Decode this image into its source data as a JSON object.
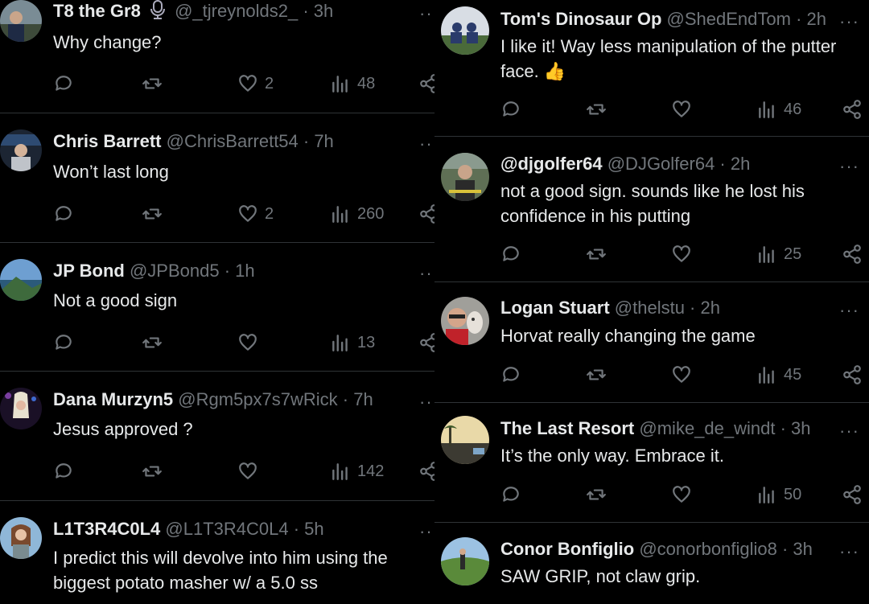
{
  "left_column": [
    {
      "name": "T8 the Gr8",
      "handle": "@_tjreynolds2_ · 3h",
      "text": "Why change?",
      "likes": "2",
      "views": "48"
    },
    {
      "name": "Chris Barrett",
      "handle": "@ChrisBarrett54 · 7h",
      "text": "Won’t last long",
      "likes": "2",
      "views": "260"
    },
    {
      "name": "JP Bond",
      "handle": "@JPBond5 · 1h",
      "text": "Not a good sign",
      "likes": "",
      "views": "13"
    },
    {
      "name": "Dana Murzyn5",
      "handle": "@Rgm5px7s7wRick · 7h",
      "text": "Jesus approved ?",
      "likes": "",
      "views": "142"
    },
    {
      "name": "L1T3R4C0L4",
      "handle": "@L1T3R4C0L4 · 5h",
      "text": "I predict this will devolve into him using the biggest potato masher w/ a 5.0 ss",
      "likes": "",
      "views": ""
    }
  ],
  "right_column": [
    {
      "name": "Tom's Dinosaur Op",
      "handle": "@ShedEndTom · 2h",
      "text": "I like it! Way less manipulation of the putter face. 👍",
      "likes": "",
      "views": "46"
    },
    {
      "name": "@djgolfer64",
      "handle": "@DJGolfer64 · 2h",
      "text": "not a good sign. sounds like he lost his confidence in his putting",
      "likes": "",
      "views": "25"
    },
    {
      "name": "Logan Stuart",
      "handle": "@thelstu · 2h",
      "text": "Horvat really changing the game",
      "likes": "",
      "views": "45"
    },
    {
      "name": "The Last Resort",
      "handle": "@mike_de_windt · 3h",
      "text": "It’s the only way. Embrace it.",
      "likes": "",
      "views": "50"
    },
    {
      "name": "Conor Bonfiglio",
      "handle": "@conorbonfiglio8 · 3h",
      "text": "SAW GRIP, not claw grip.",
      "likes": "",
      "views": ""
    }
  ],
  "more_label": "···"
}
